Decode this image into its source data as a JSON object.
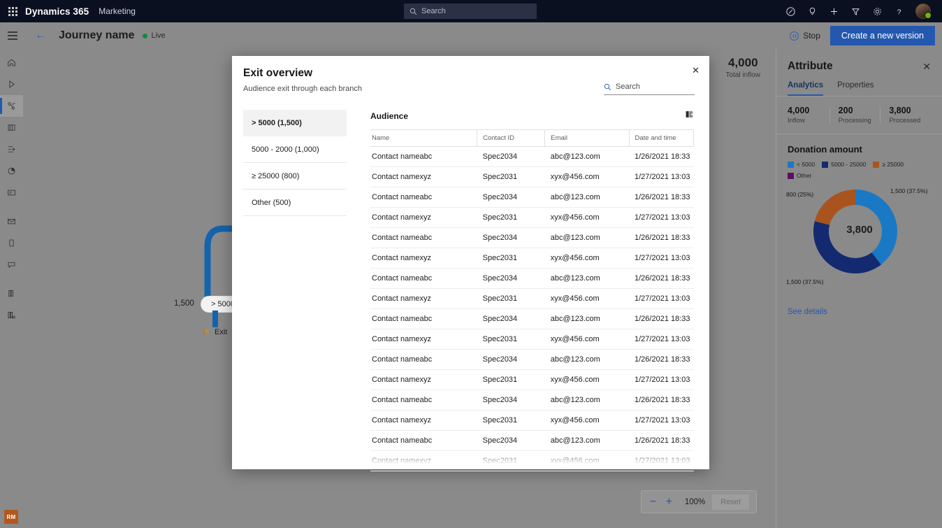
{
  "suitebar": {
    "waffle": "app-launcher",
    "brand": "Dynamics 365",
    "app": "Marketing",
    "search_placeholder": "Search",
    "icons": [
      "pencil-icon",
      "lightbulb-icon",
      "plus-icon",
      "filter-icon",
      "gear-icon",
      "help-icon"
    ],
    "avatar": "user-avatar"
  },
  "commandbar": {
    "back": "←",
    "title": "Journey name",
    "status": "Live",
    "stop_label": "Stop",
    "new_version_label": "Create a new version"
  },
  "rail": {
    "items": [
      {
        "name": "home",
        "icon": "home-icon"
      },
      {
        "name": "play",
        "icon": "play-icon"
      },
      {
        "name": "journeys",
        "icon": "journey-icon",
        "selected": true
      },
      {
        "name": "segments",
        "icon": "segments-icon"
      },
      {
        "name": "flows",
        "icon": "flow-icon"
      },
      {
        "name": "analytics",
        "icon": "pie-chart-icon"
      },
      {
        "name": "forms",
        "icon": "form-icon"
      },
      {
        "name": "email",
        "icon": "envelope-icon"
      },
      {
        "name": "mobile",
        "icon": "mobile-icon"
      },
      {
        "name": "messages",
        "icon": "message-icon"
      },
      {
        "name": "library",
        "icon": "library-icon"
      },
      {
        "name": "settings",
        "icon": "settings-list-icon"
      }
    ],
    "user_initials": "RM"
  },
  "canvas": {
    "node_count_label": "1,500",
    "node_label": "> 5000",
    "exit_label": "Exit",
    "exit_icon": "flag-icon",
    "inflow_value": "4,000",
    "inflow_label": "Total inflow",
    "zoom": {
      "minus": "−",
      "plus": "+",
      "level": "100%",
      "reset_label": "Reset"
    }
  },
  "modal": {
    "title": "Exit overview",
    "subtitle": "Audience exit through each branch",
    "close": "✕",
    "search_placeholder": "Search",
    "branches": [
      {
        "label": "> 5000 (1,500)",
        "selected": true
      },
      {
        "label": "5000 - 2000 (1,000)",
        "selected": false
      },
      {
        "label": "≥ 25000 (800)",
        "selected": false
      },
      {
        "label": "Other (500)",
        "selected": false
      }
    ],
    "audience": {
      "title": "Audience",
      "options_icon": "column-options-icon",
      "columns": [
        "Name",
        "Contact ID",
        "Email",
        "Date and time"
      ],
      "rows": [
        [
          "Contact nameabc",
          "Spec2034",
          "abc@123.com",
          "1/26/2021 18:33"
        ],
        [
          "Contact namexyz",
          "Spec2031",
          "xyx@456.com",
          "1/27/2021 13:03"
        ],
        [
          "Contact nameabc",
          "Spec2034",
          "abc@123.com",
          "1/26/2021 18:33"
        ],
        [
          "Contact namexyz",
          "Spec2031",
          "xyx@456.com",
          "1/27/2021 13:03"
        ],
        [
          "Contact nameabc",
          "Spec2034",
          "abc@123.com",
          "1/26/2021 18:33"
        ],
        [
          "Contact namexyz",
          "Spec2031",
          "xyx@456.com",
          "1/27/2021 13:03"
        ],
        [
          "Contact nameabc",
          "Spec2034",
          "abc@123.com",
          "1/26/2021 18:33"
        ],
        [
          "Contact namexyz",
          "Spec2031",
          "xyx@456.com",
          "1/27/2021 13:03"
        ],
        [
          "Contact nameabc",
          "Spec2034",
          "abc@123.com",
          "1/26/2021 18:33"
        ],
        [
          "Contact namexyz",
          "Spec2031",
          "xyx@456.com",
          "1/27/2021 13:03"
        ],
        [
          "Contact nameabc",
          "Spec2034",
          "abc@123.com",
          "1/26/2021 18:33"
        ],
        [
          "Contact namexyz",
          "Spec2031",
          "xyx@456.com",
          "1/27/2021 13:03"
        ],
        [
          "Contact nameabc",
          "Spec2034",
          "abc@123.com",
          "1/26/2021 18:33"
        ],
        [
          "Contact namexyz",
          "Spec2031",
          "xyx@456.com",
          "1/27/2021 13:03"
        ],
        [
          "Contact nameabc",
          "Spec2034",
          "abc@123.com",
          "1/26/2021 18:33"
        ],
        [
          "Contact namexyz",
          "Spec2031",
          "xyx@456.com",
          "1/27/2021 13:03"
        ]
      ]
    }
  },
  "attribute_panel": {
    "title": "Attribute",
    "close": "✕",
    "tabs": [
      {
        "label": "Analytics",
        "active": true
      },
      {
        "label": "Properties",
        "active": false
      }
    ],
    "stats": [
      {
        "value": "4,000",
        "label": "Inflow"
      },
      {
        "value": "200",
        "label": "Processing"
      },
      {
        "value": "3,800",
        "label": "Processed"
      }
    ],
    "section_title": "Donation amount",
    "see_details": "See details"
  },
  "chart_data": {
    "type": "pie",
    "title": "Donation amount",
    "center_label": "3,800",
    "legend_position": "top",
    "labels": [
      "< 5000",
      "5000 - 25000",
      "≥ 25000",
      "Other"
    ],
    "values": [
      1500,
      1500,
      800,
      0
    ],
    "percents": [
      37.5,
      37.5,
      25.0,
      0
    ],
    "colors": [
      "#1a79c4",
      "#142a70",
      "#a9541f",
      "#5c0f61"
    ],
    "data_labels": [
      {
        "text": "1,500 (37.5%)",
        "slice": "< 5000",
        "position": "right-top"
      },
      {
        "text": "1,500 (37.5%)",
        "slice": "5000 - 25000",
        "position": "left-bottom"
      },
      {
        "text": "800 (25%)",
        "slice": "≥ 25000",
        "position": "left-top"
      }
    ]
  }
}
